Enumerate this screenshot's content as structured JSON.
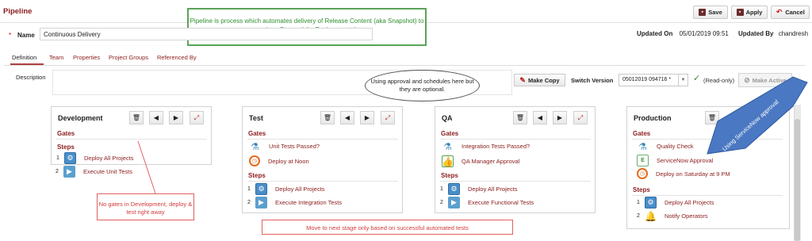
{
  "page": {
    "title": "Pipeline"
  },
  "toolbar": {
    "save": "Save",
    "apply": "Apply",
    "cancel": "Cancel"
  },
  "callouts": {
    "header_note": "Pipeline is process which automates delivery of Release Content (aka Snapshot) to various Stages (aka Environments)",
    "cloud": "Using approval and schedules here but they are optional.",
    "dev_note": "No gates in Development, deploy & test right away",
    "bottom_note": "Move to next stage only based on successful automated tests",
    "arrow_note": "Using ServiceNow approval"
  },
  "form": {
    "name_label": "Name",
    "name_value": "Continuous Delivery",
    "updated_on_label": "Updated On",
    "updated_on_value": "05/01/2019 09:51",
    "updated_by_label": "Updated By",
    "updated_by_value": "chandresh",
    "description_label": "Description"
  },
  "tabs": [
    "Definition",
    "Team",
    "Properties",
    "Project Groups",
    "Referenced By"
  ],
  "version": {
    "make_copy": "Make Copy",
    "switch_label": "Switch Version",
    "selected": "05012019 094716 *",
    "readonly": "(Read-only)",
    "make_active": "Make Active"
  },
  "labels": {
    "gates": "Gates",
    "steps": "Steps"
  },
  "stages": [
    {
      "name": "Development",
      "gates": [],
      "steps": [
        "Deploy All Projects",
        "Execute Unit Tests"
      ]
    },
    {
      "name": "Test",
      "gates": [
        "Unit Tests Passed?",
        "Deploy at Noon"
      ],
      "steps": [
        "Deploy All Projects",
        "Execute Integration Tests"
      ]
    },
    {
      "name": "QA",
      "gates": [
        "Integration Tests Passed?",
        "QA Manager Approval"
      ],
      "steps": [
        "Deploy All Projects",
        "Execute Functional Tests"
      ]
    },
    {
      "name": "Production",
      "gates": [
        "Quality Check",
        "ServiceNow Approval",
        "Deploy on Saturday at 9 PM"
      ],
      "steps": [
        "Deploy All Projects",
        "Notify Operators"
      ]
    }
  ],
  "step_numbers": [
    "1",
    "2"
  ],
  "colors": {
    "brand": "#8b1c1c",
    "note_green": "#2f8f2f",
    "note_red": "#d23b3b",
    "arrow_blue": "#4a78c2"
  }
}
